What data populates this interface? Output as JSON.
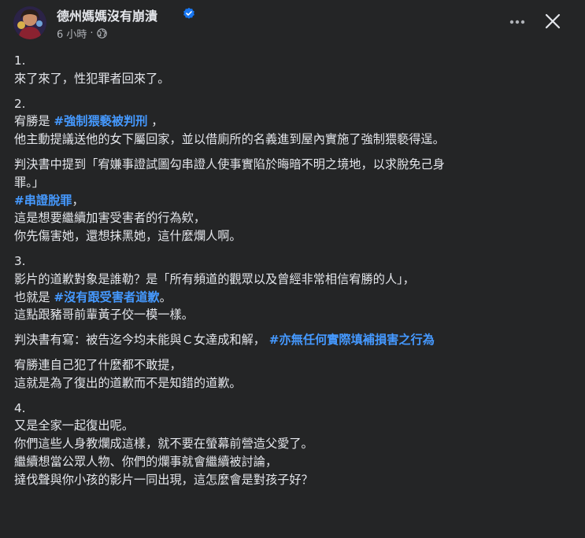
{
  "post": {
    "author": "德州媽媽沒有崩潰",
    "time": "6 小時",
    "separator": "·",
    "more_icon": "more-horizontal-icon",
    "close_icon": "close-icon",
    "verified_icon": "verified-badge-icon",
    "globe_icon": "globe-icon"
  },
  "colors": {
    "background": "#242526",
    "text": "#e4e6eb",
    "secondary": "#b0b3b8",
    "hashtag": "#4599ff",
    "verified": "#1877f2"
  },
  "body": {
    "p1": {
      "l1": "1.",
      "l2": "來了來了，性犯罪者回來了。"
    },
    "p2": {
      "l1": "2.",
      "l2_pre": "宥勝是 ",
      "l2_tag": "#強制猥褻被判刑",
      "l2_post": " ，",
      "l3": "他主動提議送他的女下屬回家，並以借廁所的名義進到屋內實施了強制猥褻得逞。"
    },
    "p3": {
      "l1": "判決書中提到「宥嫌事證試圖勾串證人使事實陷於晦暗不明之境地，以求脫免己身",
      "l2": "罪。」",
      "l3_tag": "#串證脫罪",
      "l3_post": "，",
      "l4": "這是想要繼續加害受害者的行為欸，",
      "l5": "你先傷害她，還想抹黑她，這什麼爛人啊。"
    },
    "p4": {
      "l1": "3.",
      "l2": "影片的道歉對象是誰勒？是「所有頻道的觀眾以及曾經非常相信宥勝的人」，",
      "l3_pre": "也就是 ",
      "l3_tag": "#沒有跟受害者道歉",
      "l3_post": "。",
      "l4": "這點跟豬哥前輩黃子佼一模一樣。"
    },
    "p5": {
      "l1_pre": "判決書有寫：被告迄今均未能與Ｃ女達成和解， ",
      "l1_tag": "#亦無任何實際填補損害之行為"
    },
    "p6": {
      "l1": "宥勝連自己犯了什麼都不敢提，",
      "l2": "這就是為了復出的道歉而不是知錯的道歉。"
    },
    "p7": {
      "l1": "4.",
      "l2": "又是全家一起復出呢。",
      "l3": "你們這些人身教爛成這樣，就不要在螢幕前營造父愛了。",
      "l4": "繼續想當公眾人物、你們的爛事就會繼續被討論，",
      "l5": "撻伐聲與你小孩的影片一同出現，這怎麼會是對孩子好？"
    }
  }
}
